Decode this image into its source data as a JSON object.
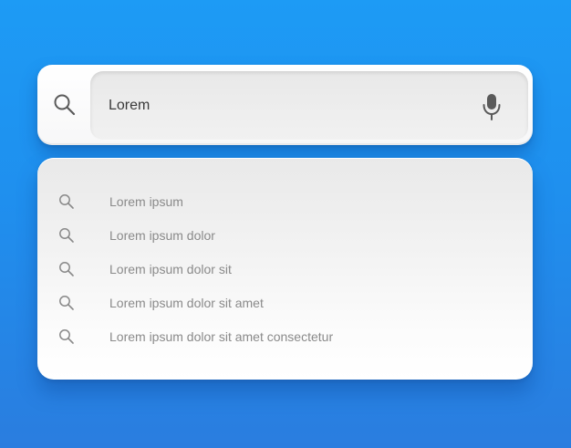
{
  "search": {
    "value": "Lorem",
    "icon": "search-icon",
    "mic_icon": "microphone-icon"
  },
  "suggestions": [
    {
      "label": "Lorem ipsum",
      "icon": "search-icon"
    },
    {
      "label": "Lorem ipsum dolor",
      "icon": "search-icon"
    },
    {
      "label": "Lorem ipsum dolor sit",
      "icon": "search-icon"
    },
    {
      "label": "Lorem ipsum dolor sit amet",
      "icon": "search-icon"
    },
    {
      "label": "Lorem ipsum dolor sit amet consectetur",
      "icon": "search-icon"
    }
  ],
  "colors": {
    "background": "#1d9bf5",
    "panel": "#ffffff",
    "field": "#ebebeb",
    "icon": "#5a5a5a",
    "suggestion_text": "#8a8a8a"
  }
}
